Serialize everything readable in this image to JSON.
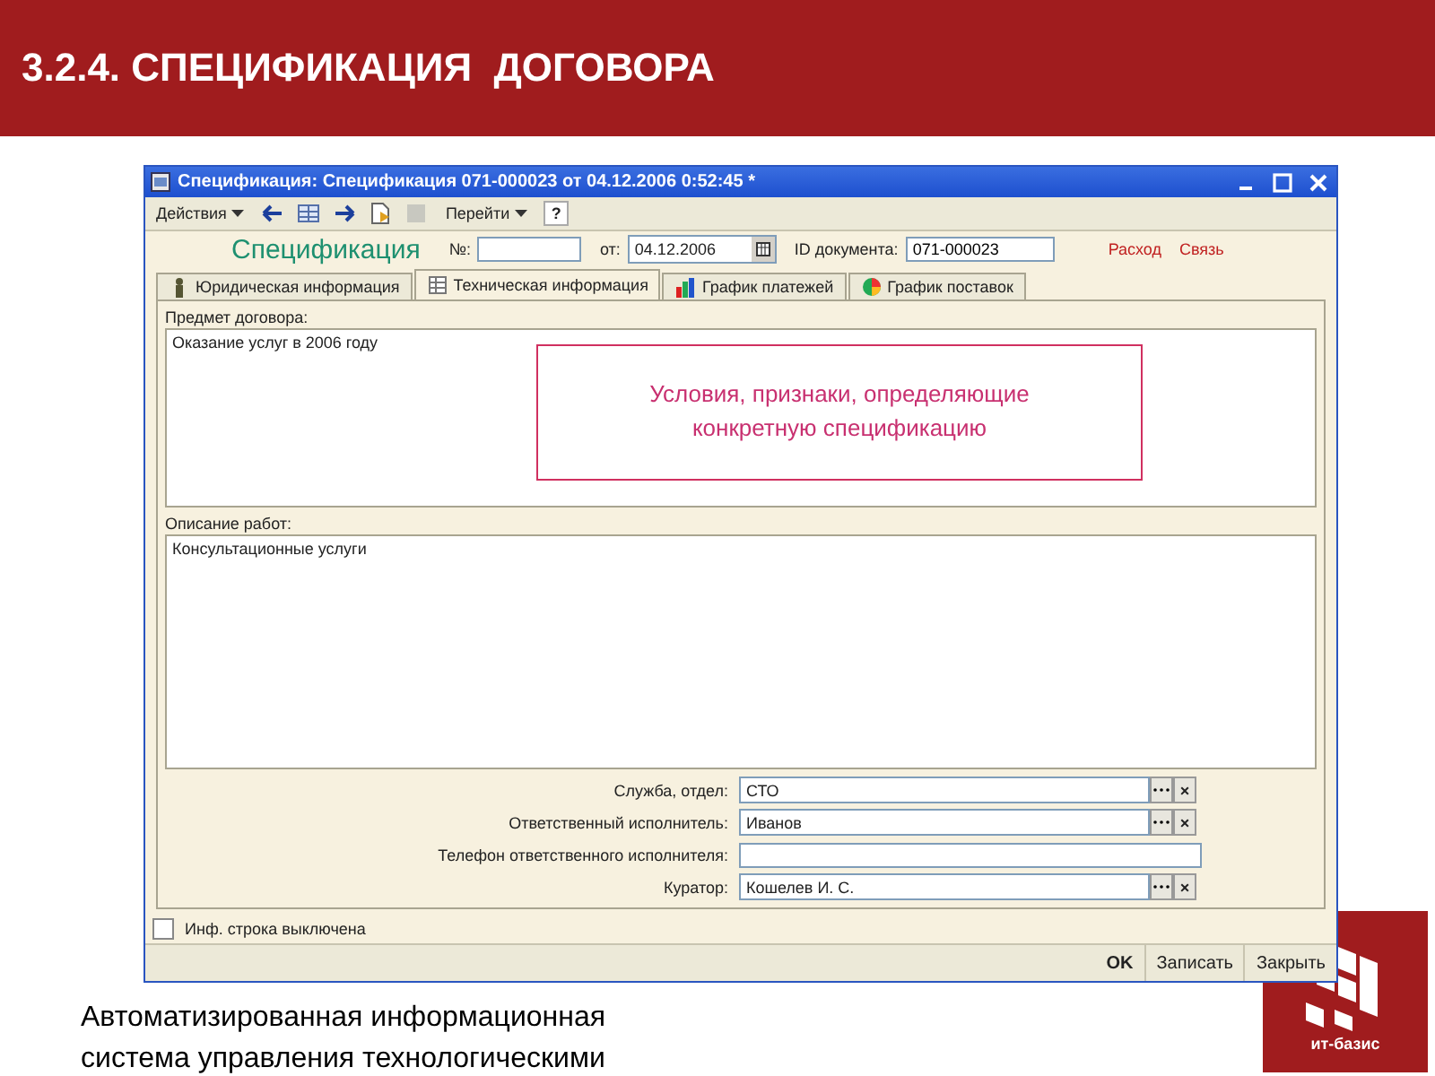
{
  "slide": {
    "title": "3.2.4. СПЕЦИФИКАЦИЯ  ДОГОВОРА",
    "caption": "Автоматизированная информационная система управления технологическими",
    "logo_text": "ит-базис"
  },
  "window": {
    "title": "Спецификация: Спецификация 071-000023 от 04.12.2006 0:52:45 *"
  },
  "toolbar": [
    {
      "kind": "menu",
      "label": "Действия"
    },
    {
      "kind": "icon"
    },
    {
      "kind": "icon"
    },
    {
      "kind": "icon"
    },
    {
      "kind": "icon"
    },
    {
      "kind": "icon"
    },
    {
      "kind": "menu",
      "label": "Перейти"
    },
    {
      "kind": "help",
      "label": "?"
    }
  ],
  "header": {
    "title": "Спецификация",
    "number_label": "№:",
    "date_label": "от:",
    "date_value": "04.12.2006",
    "id_label": "ID документа:",
    "id_value": "071-000023",
    "links": [
      "Расход",
      "Связь"
    ]
  },
  "tabs": [
    {
      "label": "Юридическая информация",
      "selected": false
    },
    {
      "label": "Техническая информация",
      "selected": true
    },
    {
      "label": "График платежей",
      "selected": false
    },
    {
      "label": "График поставок",
      "selected": false
    }
  ],
  "subject": {
    "label": "Предмет договора:",
    "value": "Оказание услуг в 2006 году"
  },
  "callout": "Условия, признаки, определяющие конкретную спецификацию",
  "description": {
    "label": "Описание работ:",
    "value": "Консультационные услуги"
  },
  "fields": [
    {
      "kind": "select",
      "label": "Служба, отдел:",
      "value": "СТО",
      "clear": "×"
    },
    {
      "kind": "select",
      "label": "Ответственный исполнитель:",
      "value": "Иванов",
      "clear": "×"
    },
    {
      "kind": "text",
      "label": "Телефон ответственного исполнителя:"
    },
    {
      "kind": "select",
      "label": "Куратор:",
      "value": "Кошелев И. С.",
      "clear": "×"
    }
  ],
  "info_line": {
    "label": "Инф. строка выключена",
    "checked": false
  },
  "buttons": [
    {
      "label": "OK",
      "default": true
    },
    {
      "label": "Записать",
      "default": false
    },
    {
      "label": "Закрыть",
      "default": false
    }
  ]
}
